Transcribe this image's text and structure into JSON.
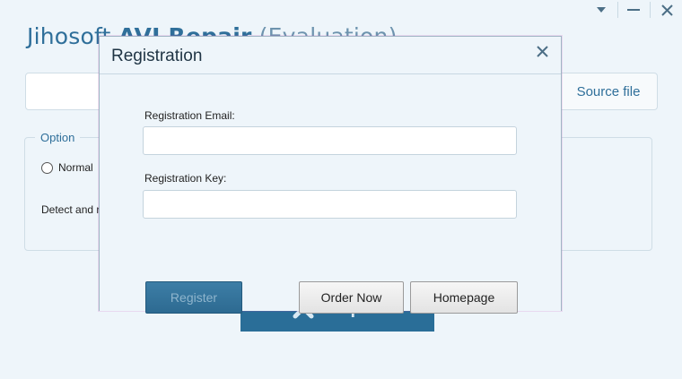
{
  "app": {
    "title_prefix": "Jihosoft ",
    "title_product": "AVI Repair",
    "title_suffix": " (Evaluation)"
  },
  "window_controls": {
    "menu_icon": "chevron-down-icon",
    "minimize_icon": "minimize-icon",
    "close_icon": "close-icon"
  },
  "main": {
    "source_button": "Source file",
    "option_legend": "Option",
    "radio_normal": "Normal",
    "detect_text": "Detect and re",
    "repair_button": "Repair"
  },
  "dialog": {
    "title": "Registration",
    "email_label": "Registration Email:",
    "email_value": "",
    "key_label": "Registration Key:",
    "key_value": "",
    "register_button": "Register",
    "order_button": "Order Now",
    "homepage_button": "Homepage"
  },
  "colors": {
    "accent": "#2f6f9a",
    "background": "#eef5fa",
    "register_button": "#2d6a91"
  }
}
